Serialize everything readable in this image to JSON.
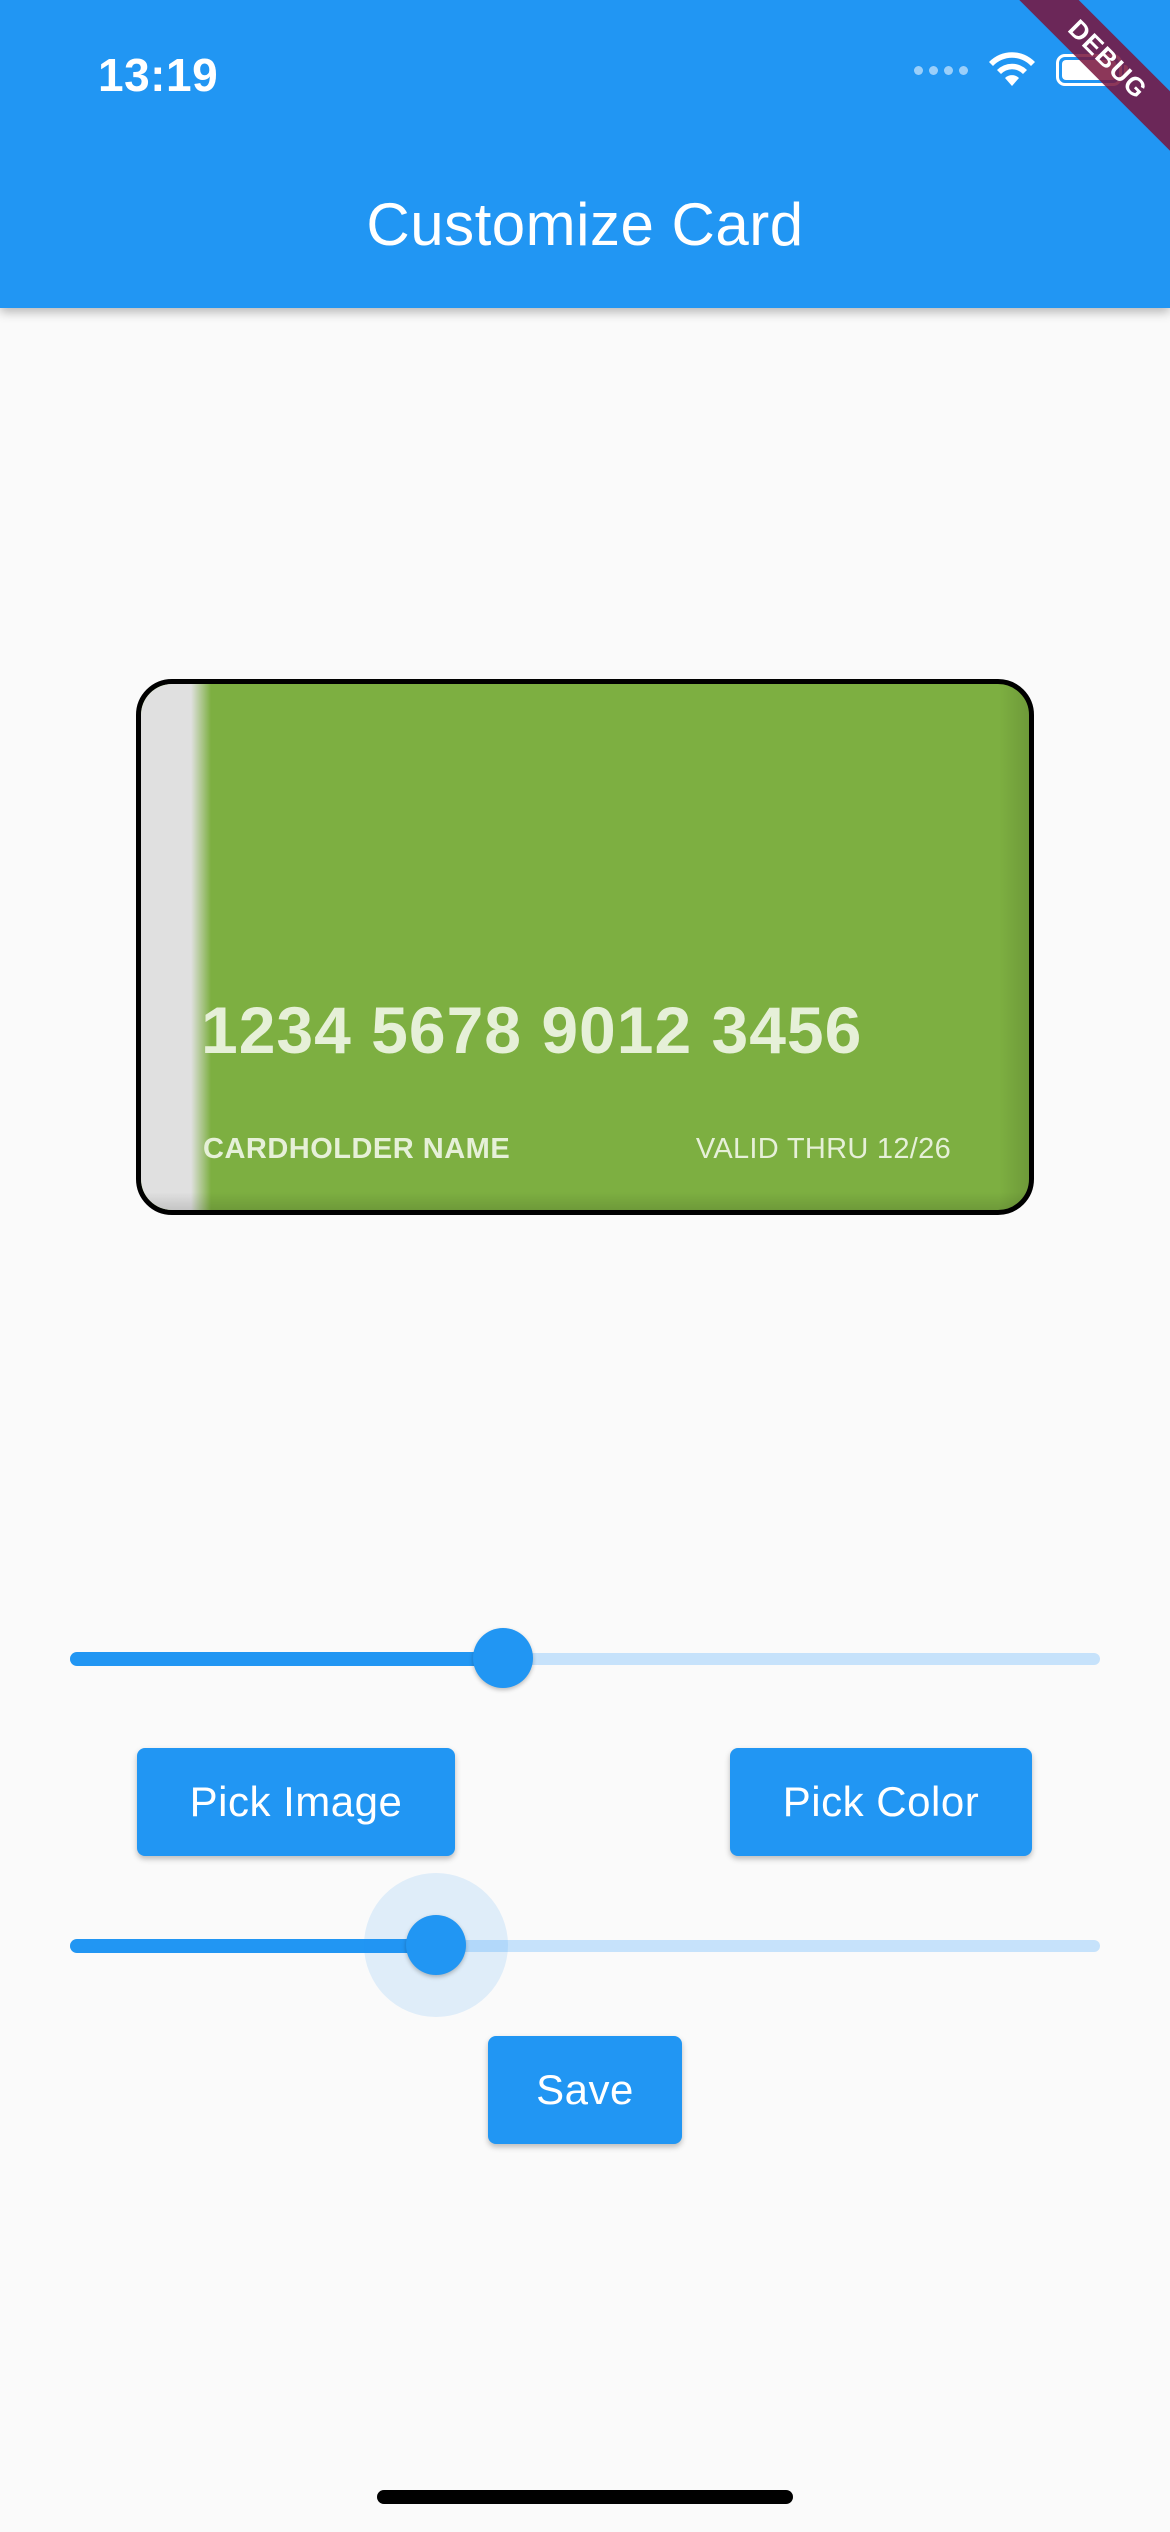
{
  "status_bar": {
    "time": "13:19",
    "icons": [
      "cellular-dots-icon",
      "wifi-icon",
      "battery-icon"
    ]
  },
  "debug_banner": "DEBUG",
  "app_bar": {
    "title": "Customize Card",
    "background_color": "#2196f3"
  },
  "card": {
    "number": "1234 5678 9012 3456",
    "holder": "CARDHOLDER NAME",
    "valid": "VALID THRU 12/26",
    "background_color": "#7daf41",
    "border_color": "#000000"
  },
  "slider_top": {
    "value": 0.42
  },
  "slider_bottom": {
    "value": 0.355,
    "focused": true
  },
  "buttons": {
    "pick_image": "Pick Image",
    "pick_color": "Pick Color",
    "save": "Save"
  },
  "colors": {
    "accent": "#2196f3",
    "slider_inactive": "#c6e2fb",
    "page_background": "#fafafa"
  }
}
